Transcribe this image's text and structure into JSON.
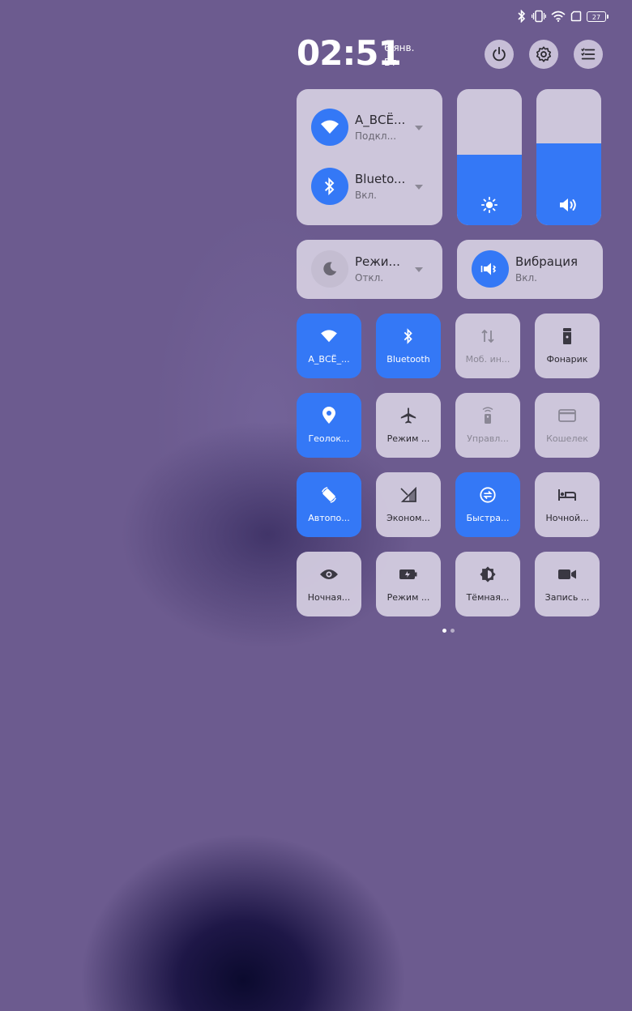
{
  "status": {
    "battery": "27"
  },
  "header": {
    "time": "02:51",
    "date": "6 янв.",
    "weekday": "Вт"
  },
  "connectivity": {
    "wifi": {
      "title": "A_ВСЁ...",
      "subtitle": "Подкл..."
    },
    "bluetooth": {
      "title": "Blueto...",
      "subtitle": "Вкл."
    }
  },
  "sliders": {
    "brightness_level": 0.52,
    "volume_level": 0.6
  },
  "modes": {
    "dnd": {
      "title": "Режи...",
      "subtitle": "Откл."
    },
    "vibration": {
      "title": "Вибрация",
      "subtitle": "Вкл."
    }
  },
  "tiles": [
    {
      "label": "A_ВСЁ_...",
      "icon": "wifi-icon",
      "state": "on"
    },
    {
      "label": "Bluetooth",
      "icon": "bluetooth-icon",
      "state": "on"
    },
    {
      "label": "Моб. ин...",
      "icon": "mobile-data-icon",
      "state": "dim"
    },
    {
      "label": "Фонарик",
      "icon": "flashlight-icon",
      "state": "off"
    },
    {
      "label": "Геолок...",
      "icon": "location-icon",
      "state": "on"
    },
    {
      "label": "Режим ...",
      "icon": "airplane-icon",
      "state": "off"
    },
    {
      "label": "Управл...",
      "icon": "remote-icon",
      "state": "dim"
    },
    {
      "label": "Кошелек",
      "icon": "wallet-icon",
      "state": "dim"
    },
    {
      "label": "Автопо...",
      "icon": "auto-rotate-icon",
      "state": "on"
    },
    {
      "label": "Эконом...",
      "icon": "data-saver-icon",
      "state": "off"
    },
    {
      "label": "Быстра...",
      "icon": "quick-share-icon",
      "state": "on"
    },
    {
      "label": "Ночной...",
      "icon": "bed-icon",
      "state": "off"
    },
    {
      "label": "Ночная...",
      "icon": "eye-icon",
      "state": "off"
    },
    {
      "label": "Режим ...",
      "icon": "battery-saver-icon",
      "state": "off"
    },
    {
      "label": "Тёмная...",
      "icon": "dark-mode-icon",
      "state": "off"
    },
    {
      "label": "Запись ...",
      "icon": "screen-record-icon",
      "state": "off"
    }
  ],
  "pagination": {
    "pages": 2,
    "current": 1
  },
  "colors": {
    "accent": "#3478f6",
    "panel": "#d6cfe2",
    "background": "#6c5b8f"
  }
}
